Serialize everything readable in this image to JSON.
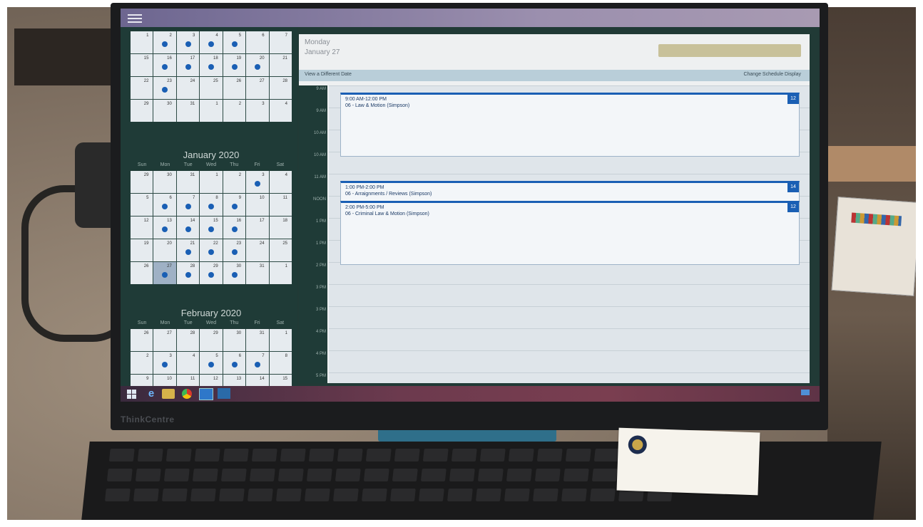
{
  "calendar_pane": {
    "prev_month": {
      "weeks": [
        [
          {
            "d": "1",
            "dot": false
          },
          {
            "d": "2",
            "dot": true
          },
          {
            "d": "3",
            "dot": true
          },
          {
            "d": "4",
            "dot": true
          },
          {
            "d": "5",
            "dot": true
          },
          {
            "d": "6",
            "dot": false
          },
          {
            "d": "7",
            "dot": false
          }
        ],
        [
          {
            "d": "15",
            "dot": false
          },
          {
            "d": "16",
            "dot": true
          },
          {
            "d": "17",
            "dot": true
          },
          {
            "d": "18",
            "dot": true
          },
          {
            "d": "19",
            "dot": true
          },
          {
            "d": "20",
            "dot": true
          },
          {
            "d": "21",
            "dot": false
          }
        ],
        [
          {
            "d": "22",
            "dot": false
          },
          {
            "d": "23",
            "dot": true
          },
          {
            "d": "24",
            "dot": false
          },
          {
            "d": "25",
            "dot": false
          },
          {
            "d": "26",
            "dot": false
          },
          {
            "d": "27",
            "dot": false
          },
          {
            "d": "28",
            "dot": false
          }
        ],
        [
          {
            "d": "29",
            "dot": false
          },
          {
            "d": "30",
            "dot": false
          },
          {
            "d": "31",
            "dot": false
          },
          {
            "d": "1",
            "dot": false
          },
          {
            "d": "2",
            "dot": false
          },
          {
            "d": "3",
            "dot": false
          },
          {
            "d": "4",
            "dot": false
          }
        ]
      ]
    },
    "january": {
      "title": "January 2020",
      "weekdays": [
        "Sun",
        "Mon",
        "Tue",
        "Wed",
        "Thu",
        "Fri",
        "Sat"
      ],
      "weeks": [
        [
          {
            "d": "29",
            "dot": false
          },
          {
            "d": "30",
            "dot": false
          },
          {
            "d": "31",
            "dot": false
          },
          {
            "d": "1",
            "dot": false
          },
          {
            "d": "2",
            "dot": false
          },
          {
            "d": "3",
            "dot": true
          },
          {
            "d": "4",
            "dot": false
          }
        ],
        [
          {
            "d": "5",
            "dot": false
          },
          {
            "d": "6",
            "dot": true
          },
          {
            "d": "7",
            "dot": true
          },
          {
            "d": "8",
            "dot": true
          },
          {
            "d": "9",
            "dot": true
          },
          {
            "d": "10",
            "dot": false
          },
          {
            "d": "11",
            "dot": false
          }
        ],
        [
          {
            "d": "12",
            "dot": false
          },
          {
            "d": "13",
            "dot": true
          },
          {
            "d": "14",
            "dot": true
          },
          {
            "d": "15",
            "dot": true
          },
          {
            "d": "16",
            "dot": true
          },
          {
            "d": "17",
            "dot": false
          },
          {
            "d": "18",
            "dot": false
          }
        ],
        [
          {
            "d": "19",
            "dot": false
          },
          {
            "d": "20",
            "dot": false
          },
          {
            "d": "21",
            "dot": true
          },
          {
            "d": "22",
            "dot": true
          },
          {
            "d": "23",
            "dot": true
          },
          {
            "d": "24",
            "dot": false
          },
          {
            "d": "25",
            "dot": false
          }
        ],
        [
          {
            "d": "26",
            "dot": false
          },
          {
            "d": "27",
            "dot": true,
            "today": true
          },
          {
            "d": "28",
            "dot": true
          },
          {
            "d": "29",
            "dot": true
          },
          {
            "d": "30",
            "dot": true
          },
          {
            "d": "31",
            "dot": false
          },
          {
            "d": "1",
            "dot": false
          }
        ]
      ]
    },
    "february": {
      "title": "February 2020",
      "weekdays": [
        "Sun",
        "Mon",
        "Tue",
        "Wed",
        "Thu",
        "Fri",
        "Sat"
      ],
      "weeks": [
        [
          {
            "d": "26",
            "dot": false
          },
          {
            "d": "27",
            "dot": false
          },
          {
            "d": "28",
            "dot": false
          },
          {
            "d": "29",
            "dot": false
          },
          {
            "d": "30",
            "dot": false
          },
          {
            "d": "31",
            "dot": false
          },
          {
            "d": "1",
            "dot": false
          }
        ],
        [
          {
            "d": "2",
            "dot": false
          },
          {
            "d": "3",
            "dot": true
          },
          {
            "d": "4",
            "dot": false
          },
          {
            "d": "5",
            "dot": true
          },
          {
            "d": "6",
            "dot": true
          },
          {
            "d": "7",
            "dot": true
          },
          {
            "d": "8",
            "dot": false
          }
        ],
        [
          {
            "d": "9",
            "dot": false
          },
          {
            "d": "10",
            "dot": false
          },
          {
            "d": "11",
            "dot": false
          },
          {
            "d": "12",
            "dot": false
          },
          {
            "d": "13",
            "dot": false
          },
          {
            "d": "14",
            "dot": false
          },
          {
            "d": "15",
            "dot": false
          }
        ]
      ]
    }
  },
  "day_view": {
    "day_name": "Monday",
    "date": "January 27",
    "toolbar_left": "View a Different Date",
    "toolbar_right": "Change Schedule Display",
    "times": [
      "9 AM",
      "9 AM",
      "10 AM",
      "10 AM",
      "11 AM",
      "NOON",
      "1 PM",
      "1 PM",
      "2 PM",
      "3 PM",
      "3 PM",
      "4 PM",
      "4 PM",
      "5 PM"
    ],
    "events": [
      {
        "time": "9:00 AM-12:00 PM",
        "title": "06 - Law & Motion (Simpson)",
        "badge": "12"
      },
      {
        "time": "1:00 PM-2:00 PM",
        "title": "06 - Arraignments / Reviews (Simpson)",
        "badge": "14"
      },
      {
        "time": "2:00 PM-5:00 PM",
        "title": "06 - Criminal Law & Motion (Simpson)",
        "badge": "12"
      }
    ]
  },
  "bezel": {
    "brand": "ThinkCentre"
  },
  "colors": {
    "accent": "#1a5fb4",
    "pane": "#1f3b37",
    "titlebar": "#8c82a6"
  }
}
